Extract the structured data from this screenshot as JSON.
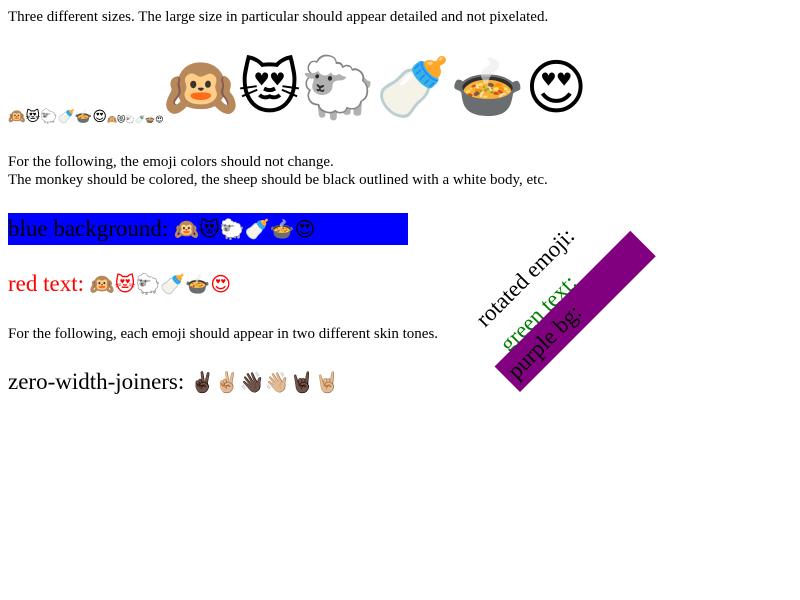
{
  "intro": "Three different sizes. The large size in particular should appear detailed and not pixelated.",
  "emoji_row": {
    "small": [
      "🙉",
      "😻",
      "🐑",
      "🍼",
      "🍲",
      "😍"
    ],
    "tiny": [
      "🙉",
      "😻",
      "🐑",
      "🍼",
      "🍲",
      "😍"
    ],
    "large": [
      "🙉",
      "😻",
      "🐑",
      "🍼",
      "🍲",
      "😍"
    ]
  },
  "color_note_line1": "For the following, the emoji colors should not change.",
  "color_note_line2": "The monkey should be colored, the sheep should be black outlined with a white body, etc.",
  "blue_background": {
    "label": "blue background: ",
    "emoji": "🙉😻🐑🍼🍲😍",
    "bg_color": "#0000ff"
  },
  "red_text": {
    "label": "red text: ",
    "emoji": "🙉😻🐑🍼🍲😍",
    "color": "#ff0000"
  },
  "skin_note": "For the following, each emoji should appear in two different skin tones.",
  "zwj": {
    "label": "zero-width-joiners: ",
    "emoji": "✌🏿✌🏼👋🏿👋🏼🤘🏿🤘🏼"
  },
  "rotated": {
    "emoji_label": "rotated emoji:",
    "green_label": "green text:",
    "green_color": "#008000",
    "purple_label": "purple bg:",
    "purple_color": "#800080"
  }
}
